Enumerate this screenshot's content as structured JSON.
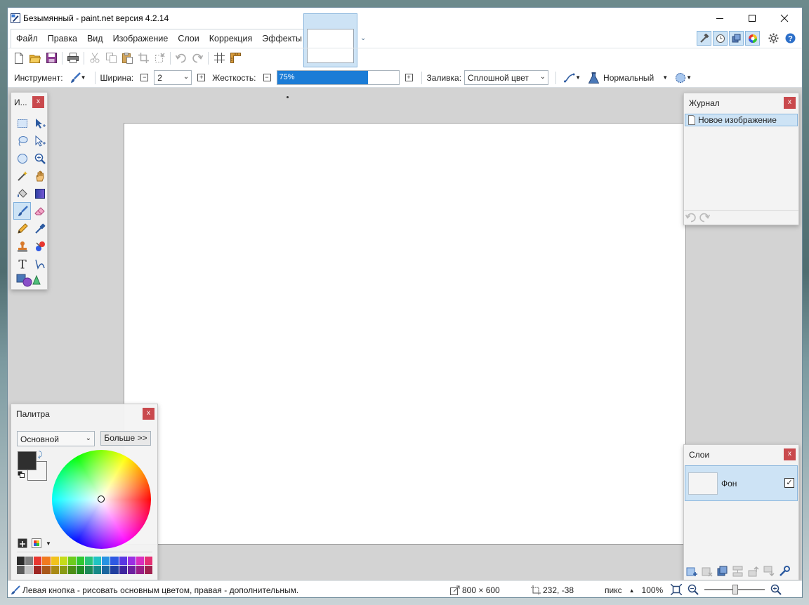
{
  "window": {
    "title": "Безымянный - paint.net версия 4.2.14",
    "controls": [
      "minimize",
      "maximize",
      "close"
    ]
  },
  "menu": {
    "items": [
      "Файл",
      "Правка",
      "Вид",
      "Изображение",
      "Слои",
      "Коррекция",
      "Эффекты"
    ]
  },
  "toolbar_top": {
    "icons": [
      "new-file",
      "open-file",
      "save-file",
      "print",
      "cut",
      "copy",
      "paste",
      "crop",
      "deselect",
      "undo",
      "redo",
      "grid",
      "ruler"
    ]
  },
  "tool_options": {
    "tool_label": "Инструмент:",
    "width_label": "Ширина:",
    "width_value": "2",
    "hardness_label": "Жесткость:",
    "hardness_value": "75%",
    "hardness_fraction": 0.75,
    "fill_label": "Заливка:",
    "fill_value": "Сплошной цвет",
    "blend_mode": "Нормальный"
  },
  "tools_panel": {
    "title": "И...",
    "close": "x",
    "active_tool": "paintbrush"
  },
  "history_panel": {
    "title": "Журнал",
    "close": "x",
    "items": [
      "Новое изображение"
    ]
  },
  "layers_panel": {
    "title": "Слои",
    "close": "x",
    "layers": [
      {
        "name": "Фон",
        "visible": "✓"
      }
    ]
  },
  "palette_panel": {
    "title": "Палитра",
    "close": "x",
    "mode": "Основной",
    "more_button": "Больше >>",
    "primary_color": "#2f2f2f",
    "secondary_color": "#f4f4f4",
    "strip_colors": [
      "#2b2b2b",
      "#7f7f7f",
      "#e8362f",
      "#f07a1f",
      "#f2c21c",
      "#c6dc1a",
      "#6ccc1d",
      "#2fc832",
      "#27c47b",
      "#1fc4c2",
      "#2793e3",
      "#2f59e3",
      "#5a37e3",
      "#9b2fe3",
      "#d92fc0",
      "#e52f74",
      "#5b5b5b",
      "#c4c4c4",
      "#9e2622",
      "#a9581a",
      "#a98a16",
      "#8a9b15",
      "#4c8e16",
      "#218d25",
      "#1d8a58",
      "#178a88",
      "#1c679f",
      "#213f9f",
      "#3f269f",
      "#6d219f",
      "#991f87",
      "#a1214f"
    ]
  },
  "status": {
    "hint": "Левая кнопка - рисовать основным цветом, правая - дополнительным.",
    "image_size": "800 × 600",
    "cursor_pos": "232, -38",
    "units": "пикс",
    "zoom": "100%"
  }
}
